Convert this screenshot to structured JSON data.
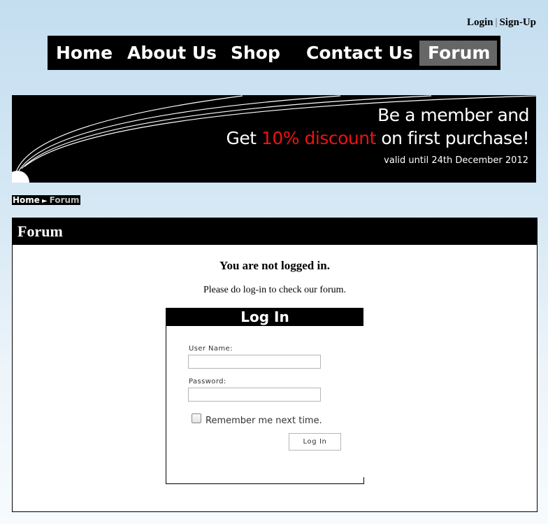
{
  "account": {
    "login_label": "Login",
    "separator": "|",
    "signup_label": "Sign-Up"
  },
  "nav": {
    "items": [
      {
        "label": "Home"
      },
      {
        "label": "About Us"
      },
      {
        "label": "Shop"
      },
      {
        "label": "Contact Us"
      },
      {
        "label": "Forum",
        "active": true
      }
    ]
  },
  "banner": {
    "line1": "Be a member and",
    "line2_prefix": "Get ",
    "line2_highlight": "10% discount",
    "line2_suffix": " on first purchase!",
    "line3": "valid until 24th December 2012",
    "highlight_color": "#ee1111"
  },
  "breadcrumb": {
    "home": "Home",
    "separator": "►",
    "current": "Forum"
  },
  "forum": {
    "title": "Forum",
    "notice_title": "You are not logged in.",
    "notice_text": "Please do log-in to check our forum."
  },
  "login_form": {
    "title": "Log In",
    "username_label": "User Name:",
    "username_value": "",
    "password_label": "Password:",
    "password_value": "",
    "remember_label": "Remember me next time.",
    "remember_checked": false,
    "submit_label": "Log In"
  },
  "colors": {
    "nav_background": "#000000",
    "nav_active": "#666666",
    "page_gradient_top": "#c4def0"
  }
}
